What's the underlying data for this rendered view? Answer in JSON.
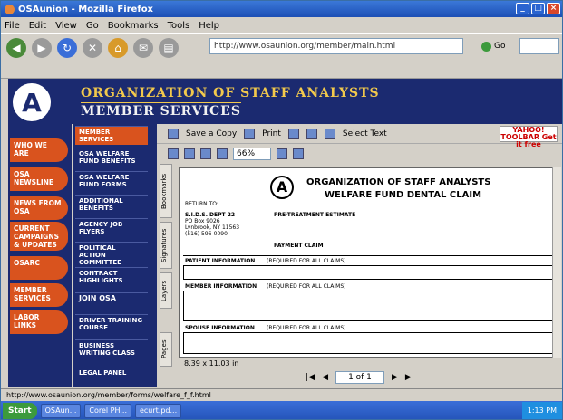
{
  "window": {
    "title": "OSAunion - Mozilla Firefox",
    "controls": [
      "_",
      "□",
      "×"
    ]
  },
  "menu": [
    "File",
    "Edit",
    "View",
    "Go",
    "Bookmarks",
    "Tools",
    "Help"
  ],
  "nav": {
    "url": "http://www.osaunion.org/member/main.html",
    "go_label": "Go",
    "search_value": ""
  },
  "header": {
    "logo": "A",
    "org_title": "ORGANIZATION OF STAFF ANALYSTS",
    "svc_title": "MEMBER SERVICES"
  },
  "left_nav": [
    "WHO WE ARE",
    "OSA NEWSLINE",
    "NEWS FROM OSA",
    "CURRENT CAMPAIGNS & UPDATES",
    "OSARC",
    "MEMBER SERVICES",
    "LABOR LINKS"
  ],
  "sub_nav": [
    "MEMBER SERVICES",
    "OSA WELFARE FUND BENEFITS",
    "OSA WELFARE FUND FORMS",
    "ADDITIONAL BENEFITS",
    "AGENCY JOB FLYERS",
    "POLITICAL ACTION COMMITTEE",
    "CONTRACT HIGHLIGHTS",
    "JOIN OSA",
    "DRIVER TRAINING COURSE",
    "BUSINESS WRITING CLASS",
    "LEGAL PANEL"
  ],
  "pdf": {
    "save_label": "Save a Copy",
    "print_label": "Print",
    "select_text_label": "Select Text",
    "zoom": "66%",
    "yahoo": "YAHOO! TOOLBAR Get it free",
    "tabs": [
      "Bookmarks",
      "Signatures",
      "Layers",
      "Pages"
    ],
    "size": "8.39 x 11.03 in",
    "page": "1 of 1"
  },
  "doc": {
    "org": "ORGANIZATION OF STAFF ANALYSTS",
    "claim": "WELFARE FUND DENTAL CLAIM",
    "return_to": "RETURN TO:",
    "address": [
      "S.I.D.S. DEPT 22",
      "PO Box 9026",
      "Lynbrook, NY 11563",
      "(516) 596-0090"
    ],
    "pre_treatment": "PRE-TREATMENT ESTIMATE",
    "payment_claim": "PAYMENT CLAIM",
    "patient_info": "PATIENT INFORMATION",
    "patient_req": "(REQUIRED FOR ALL CLAIMS)",
    "member_info": "MEMBER INFORMATION",
    "member_req": "(REQUIRED FOR ALL CLAIMS)",
    "spouse_info": "SPOUSE INFORMATION",
    "spouse_req": "(REQUIRED FOR ALL CLAIMS)"
  },
  "status": "http://www.osaunion.org/member/forms/welfare_f_f.html",
  "taskbar": {
    "start": "Start",
    "items": [
      "OSAun...",
      "Corel PH...",
      "ecurt.pd..."
    ],
    "time": "1:13 PM"
  }
}
